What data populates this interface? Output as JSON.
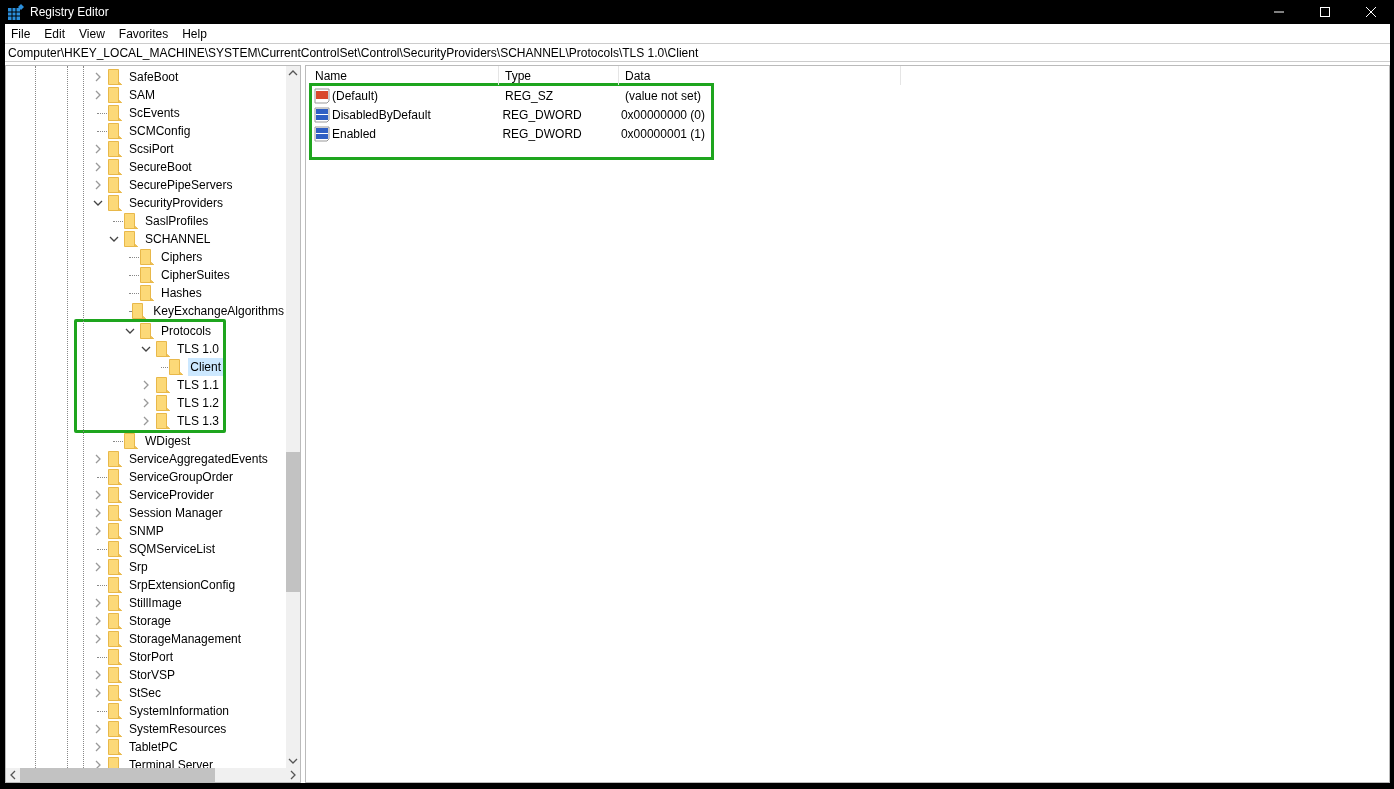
{
  "window": {
    "title": "Registry Editor"
  },
  "menu": [
    "File",
    "Edit",
    "View",
    "Favorites",
    "Help"
  ],
  "address": "Computer\\HKEY_LOCAL_MACHINE\\SYSTEM\\CurrentControlSet\\Control\\SecurityProviders\\SCHANNEL\\Protocols\\TLS 1.0\\Client",
  "tree": [
    {
      "label": "SafeBoot",
      "kind": "branch",
      "expanded": false,
      "selected": false
    },
    {
      "label": "SAM",
      "kind": "branch",
      "expanded": false,
      "selected": false
    },
    {
      "label": "ScEvents",
      "kind": "leaf",
      "selected": false
    },
    {
      "label": "SCMConfig",
      "kind": "leaf",
      "selected": false
    },
    {
      "label": "ScsiPort",
      "kind": "branch",
      "expanded": false,
      "selected": false
    },
    {
      "label": "SecureBoot",
      "kind": "branch",
      "expanded": false,
      "selected": false
    },
    {
      "label": "SecurePipeServers",
      "kind": "branch",
      "expanded": false,
      "selected": false
    },
    {
      "label": "SecurityProviders",
      "kind": "branch",
      "expanded": true,
      "selected": false,
      "children": [
        {
          "label": "SaslProfiles",
          "kind": "leaf",
          "selected": false
        },
        {
          "label": "SCHANNEL",
          "kind": "branch",
          "expanded": true,
          "selected": false,
          "children": [
            {
              "label": "Ciphers",
              "kind": "leaf",
              "selected": false
            },
            {
              "label": "CipherSuites",
              "kind": "leaf",
              "selected": false
            },
            {
              "label": "Hashes",
              "kind": "leaf",
              "selected": false
            },
            {
              "label": "KeyExchangeAlgorithms",
              "kind": "leaf",
              "selected": false
            },
            {
              "label": "Protocols",
              "kind": "branch",
              "expanded": true,
              "selected": false,
              "highlighted": true,
              "children": [
                {
                  "label": "TLS 1.0",
                  "kind": "branch",
                  "expanded": true,
                  "selected": false,
                  "children": [
                    {
                      "label": "Client",
                      "kind": "leaf",
                      "selected": true
                    }
                  ]
                },
                {
                  "label": "TLS 1.1",
                  "kind": "branch",
                  "expanded": false,
                  "selected": false
                },
                {
                  "label": "TLS 1.2",
                  "kind": "branch",
                  "expanded": false,
                  "selected": false
                },
                {
                  "label": "TLS 1.3",
                  "kind": "branch",
                  "expanded": false,
                  "selected": false
                }
              ]
            }
          ]
        },
        {
          "label": "WDigest",
          "kind": "leaf",
          "selected": false
        }
      ]
    },
    {
      "label": "ServiceAggregatedEvents",
      "kind": "branch",
      "expanded": false,
      "selected": false
    },
    {
      "label": "ServiceGroupOrder",
      "kind": "leaf",
      "selected": false
    },
    {
      "label": "ServiceProvider",
      "kind": "branch",
      "expanded": false,
      "selected": false
    },
    {
      "label": "Session Manager",
      "kind": "branch",
      "expanded": false,
      "selected": false
    },
    {
      "label": "SNMP",
      "kind": "branch",
      "expanded": false,
      "selected": false
    },
    {
      "label": "SQMServiceList",
      "kind": "leaf",
      "selected": false
    },
    {
      "label": "Srp",
      "kind": "branch",
      "expanded": false,
      "selected": false
    },
    {
      "label": "SrpExtensionConfig",
      "kind": "leaf",
      "selected": false
    },
    {
      "label": "StillImage",
      "kind": "branch",
      "expanded": false,
      "selected": false
    },
    {
      "label": "Storage",
      "kind": "branch",
      "expanded": false,
      "selected": false
    },
    {
      "label": "StorageManagement",
      "kind": "branch",
      "expanded": false,
      "selected": false
    },
    {
      "label": "StorPort",
      "kind": "leaf",
      "selected": false
    },
    {
      "label": "StorVSP",
      "kind": "branch",
      "expanded": false,
      "selected": false
    },
    {
      "label": "StSec",
      "kind": "branch",
      "expanded": false,
      "selected": false
    },
    {
      "label": "SystemInformation",
      "kind": "leaf",
      "selected": false
    },
    {
      "label": "SystemResources",
      "kind": "branch",
      "expanded": false,
      "selected": false
    },
    {
      "label": "TabletPC",
      "kind": "branch",
      "expanded": false,
      "selected": false
    },
    {
      "label": "Terminal Server",
      "kind": "branch",
      "expanded": false,
      "selected": false
    }
  ],
  "values": {
    "highlighted": true,
    "columns": [
      "Name",
      "Type",
      "Data"
    ],
    "rows": [
      {
        "kind": "string",
        "name": "(Default)",
        "type": "REG_SZ",
        "data": "(value not set)"
      },
      {
        "kind": "binary",
        "name": "DisabledByDefault",
        "type": "REG_DWORD",
        "data": "0x00000000 (0)"
      },
      {
        "kind": "binary",
        "name": "Enabled",
        "type": "REG_DWORD",
        "data": "0x00000001 (1)"
      }
    ]
  }
}
